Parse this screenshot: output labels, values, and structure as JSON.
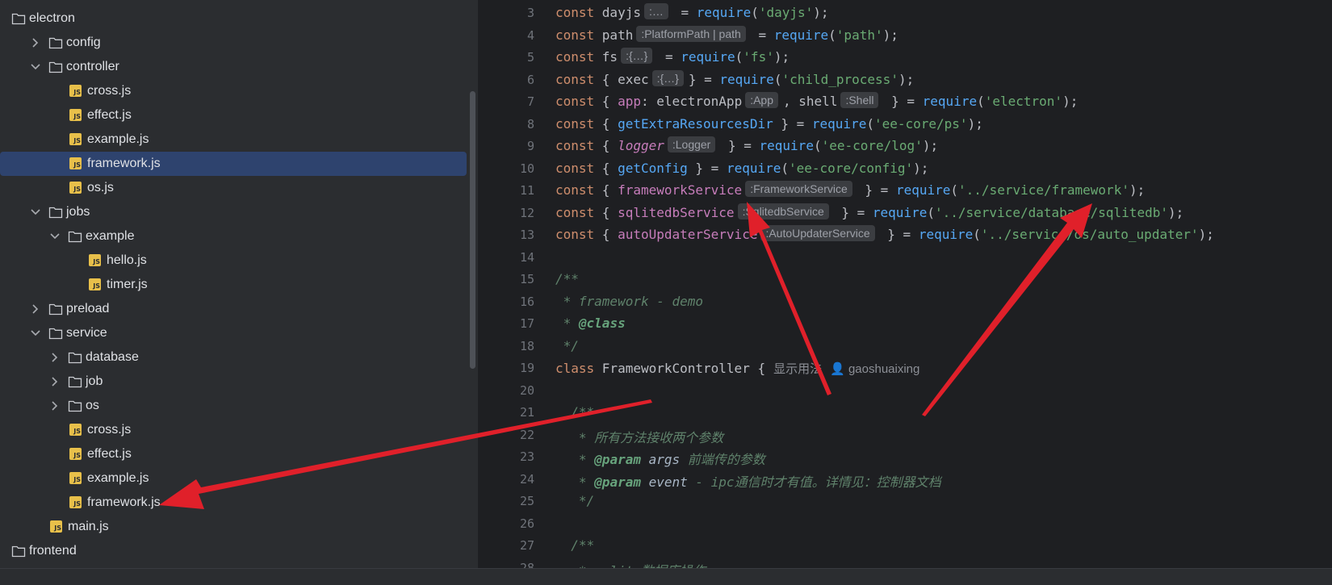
{
  "tree": [
    {
      "label": "electron",
      "type": "folder",
      "depth": 0,
      "chevron": "none"
    },
    {
      "label": "config",
      "type": "folder",
      "depth": 1,
      "chevron": "right"
    },
    {
      "label": "controller",
      "type": "folder",
      "depth": 1,
      "chevron": "down"
    },
    {
      "label": "cross.js",
      "type": "file",
      "depth": 2
    },
    {
      "label": "effect.js",
      "type": "file",
      "depth": 2
    },
    {
      "label": "example.js",
      "type": "file",
      "depth": 2
    },
    {
      "label": "framework.js",
      "type": "file",
      "depth": 2,
      "selected": true
    },
    {
      "label": "os.js",
      "type": "file",
      "depth": 2
    },
    {
      "label": "jobs",
      "type": "folder",
      "depth": 1,
      "chevron": "down"
    },
    {
      "label": "example",
      "type": "folder",
      "depth": 2,
      "chevron": "down"
    },
    {
      "label": "hello.js",
      "type": "file",
      "depth": 3
    },
    {
      "label": "timer.js",
      "type": "file",
      "depth": 3
    },
    {
      "label": "preload",
      "type": "folder",
      "depth": 1,
      "chevron": "right"
    },
    {
      "label": "service",
      "type": "folder",
      "depth": 1,
      "chevron": "down"
    },
    {
      "label": "database",
      "type": "folder",
      "depth": 2,
      "chevron": "right"
    },
    {
      "label": "job",
      "type": "folder",
      "depth": 2,
      "chevron": "right"
    },
    {
      "label": "os",
      "type": "folder",
      "depth": 2,
      "chevron": "right"
    },
    {
      "label": "cross.js",
      "type": "file",
      "depth": 2
    },
    {
      "label": "effect.js",
      "type": "file",
      "depth": 2
    },
    {
      "label": "example.js",
      "type": "file",
      "depth": 2
    },
    {
      "label": "framework.js",
      "type": "file",
      "depth": 2
    },
    {
      "label": "main.js",
      "type": "file",
      "depth": 1
    },
    {
      "label": "frontend",
      "type": "folder",
      "depth": 0,
      "chevron": "none"
    }
  ],
  "file_badge": "JS",
  "code_lines": [
    {
      "n": "3",
      "t": [
        [
          "kw",
          "const "
        ],
        [
          "",
          "dayjs"
        ],
        [
          "hint",
          ":…"
        ],
        [
          "",
          " = "
        ],
        [
          "fn",
          "require"
        ],
        [
          "",
          "("
        ],
        [
          "str",
          "'dayjs'"
        ],
        [
          "",
          ");"
        ]
      ]
    },
    {
      "n": "4",
      "t": [
        [
          "kw",
          "const "
        ],
        [
          "",
          "path"
        ],
        [
          "hint",
          ":PlatformPath | path"
        ],
        [
          "",
          " = "
        ],
        [
          "fn",
          "require"
        ],
        [
          "",
          "("
        ],
        [
          "str",
          "'path'"
        ],
        [
          "",
          ");"
        ]
      ]
    },
    {
      "n": "5",
      "t": [
        [
          "kw",
          "const "
        ],
        [
          "",
          "fs"
        ],
        [
          "hint",
          ":{…}"
        ],
        [
          "",
          " = "
        ],
        [
          "fn",
          "require"
        ],
        [
          "",
          "("
        ],
        [
          "str",
          "'fs'"
        ],
        [
          "",
          ");"
        ]
      ]
    },
    {
      "n": "6",
      "t": [
        [
          "kw",
          "const "
        ],
        [
          "",
          "{ exec"
        ],
        [
          "hint",
          ":{…}"
        ],
        [
          "",
          "} = "
        ],
        [
          "fn",
          "require"
        ],
        [
          "",
          "("
        ],
        [
          "str",
          "'child_process'"
        ],
        [
          "",
          ");"
        ]
      ]
    },
    {
      "n": "7",
      "t": [
        [
          "kw",
          "const "
        ],
        [
          "",
          "{ "
        ],
        [
          "prop",
          "app"
        ],
        [
          "",
          ": electronApp"
        ],
        [
          "hint",
          ":App"
        ],
        [
          "",
          ", shell"
        ],
        [
          "hint",
          ":Shell"
        ],
        [
          "",
          " } = "
        ],
        [
          "fn",
          "require"
        ],
        [
          "",
          "("
        ],
        [
          "str",
          "'electron'"
        ],
        [
          "",
          ");"
        ]
      ]
    },
    {
      "n": "8",
      "t": [
        [
          "kw",
          "const "
        ],
        [
          "",
          "{ "
        ],
        [
          "fn",
          "getExtraResourcesDir"
        ],
        [
          "",
          " } = "
        ],
        [
          "fn",
          "require"
        ],
        [
          "",
          "("
        ],
        [
          "str",
          "'ee-core/ps'"
        ],
        [
          "",
          ");"
        ]
      ]
    },
    {
      "n": "9",
      "t": [
        [
          "kw",
          "const "
        ],
        [
          "",
          "{ "
        ],
        [
          "var",
          "logger"
        ],
        [
          "hint",
          ":Logger"
        ],
        [
          "",
          " } = "
        ],
        [
          "fn",
          "require"
        ],
        [
          "",
          "("
        ],
        [
          "str",
          "'ee-core/log'"
        ],
        [
          "",
          ");"
        ]
      ]
    },
    {
      "n": "10",
      "t": [
        [
          "kw",
          "const "
        ],
        [
          "",
          "{ "
        ],
        [
          "fn",
          "getConfig"
        ],
        [
          "",
          " } = "
        ],
        [
          "fn",
          "require"
        ],
        [
          "",
          "("
        ],
        [
          "str",
          "'ee-core/config'"
        ],
        [
          "",
          ");"
        ]
      ]
    },
    {
      "n": "11",
      "t": [
        [
          "kw",
          "const "
        ],
        [
          "",
          "{ "
        ],
        [
          "prop",
          "frameworkService"
        ],
        [
          "hint",
          ":FrameworkService"
        ],
        [
          "",
          " } = "
        ],
        [
          "fn",
          "require"
        ],
        [
          "",
          "("
        ],
        [
          "str",
          "'../service/framework'"
        ],
        [
          "",
          ");"
        ]
      ]
    },
    {
      "n": "12",
      "t": [
        [
          "kw",
          "const "
        ],
        [
          "",
          "{ "
        ],
        [
          "prop",
          "sqlitedbService"
        ],
        [
          "hint",
          ":SqlitedbService"
        ],
        [
          "",
          " } = "
        ],
        [
          "fn",
          "require"
        ],
        [
          "",
          "("
        ],
        [
          "str",
          "'../service/database/sqlitedb'"
        ],
        [
          "",
          ");"
        ]
      ]
    },
    {
      "n": "13",
      "t": [
        [
          "kw",
          "const "
        ],
        [
          "",
          "{ "
        ],
        [
          "prop",
          "autoUpdaterService"
        ],
        [
          "hint",
          ":AutoUpdaterService"
        ],
        [
          "",
          " } = "
        ],
        [
          "fn",
          "require"
        ],
        [
          "",
          "("
        ],
        [
          "str",
          "'../service/os/auto_updater'"
        ],
        [
          "",
          ");"
        ]
      ]
    },
    {
      "n": "14",
      "t": []
    },
    {
      "n": "15",
      "t": [
        [
          "doc",
          "/**"
        ]
      ]
    },
    {
      "n": "16",
      "t": [
        [
          "doc",
          " * framework - demo"
        ]
      ]
    },
    {
      "n": "17",
      "t": [
        [
          "doc",
          " * "
        ],
        [
          "tag",
          "@class"
        ]
      ]
    },
    {
      "n": "18",
      "t": [
        [
          "doc",
          " */"
        ]
      ]
    },
    {
      "n": "19",
      "t": [
        [
          "kw",
          "class "
        ],
        [
          "",
          "FrameworkController {"
        ],
        [
          "inlay",
          "显示用法"
        ],
        [
          "inlay",
          "👤 gaoshuaixing"
        ]
      ]
    },
    {
      "n": "20",
      "t": []
    },
    {
      "n": "21",
      "t": [
        [
          "doc",
          "  /**"
        ]
      ]
    },
    {
      "n": "22",
      "t": [
        [
          "doc",
          "   * 所有方法接收两个参数"
        ]
      ]
    },
    {
      "n": "23",
      "t": [
        [
          "doc",
          "   * "
        ],
        [
          "tag",
          "@param"
        ],
        [
          "param",
          " args"
        ],
        [
          "doc",
          " 前端传的参数"
        ]
      ]
    },
    {
      "n": "24",
      "t": [
        [
          "doc",
          "   * "
        ],
        [
          "tag",
          "@param"
        ],
        [
          "param",
          " event"
        ],
        [
          "doc",
          " - ipc通信时才有值。详情见：控制器文档"
        ]
      ]
    },
    {
      "n": "25",
      "t": [
        [
          "doc",
          "   */"
        ]
      ]
    },
    {
      "n": "26",
      "t": []
    },
    {
      "n": "27",
      "t": [
        [
          "doc",
          "  /**"
        ]
      ]
    },
    {
      "n": "28",
      "t": [
        [
          "doc",
          "   * sqlite数据库操作"
        ]
      ]
    }
  ],
  "colors": {
    "arrow": "#e0202a",
    "selected": "#2e436e",
    "file_badge": "#e8c04a"
  }
}
